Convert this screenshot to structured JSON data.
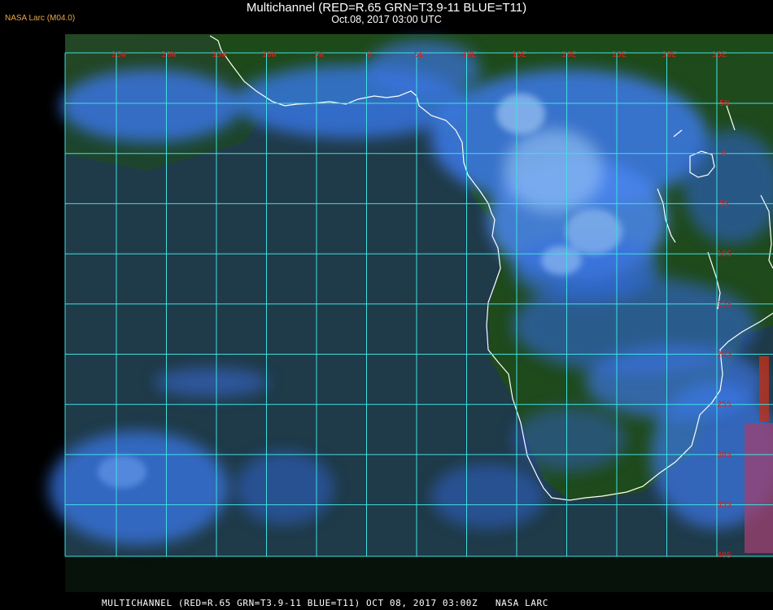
{
  "header": {
    "title": "Multichannel (RED=R.65 GRN=T3.9-11 BLUE=T11)",
    "subtitle": "Oct.08, 2017 03:00 UTC",
    "credit": "NASA Larc (M04.0)"
  },
  "footer": {
    "caption": "MULTICHANNEL (RED=R.65 GRN=T3.9-11 BLUE=T11) OCT 08, 2017 03:00Z   NASA LARC"
  },
  "map": {
    "region": "Southern Africa / South Atlantic",
    "lon_labels": [
      "25W",
      "20W",
      "15W",
      "10W",
      "5W",
      "0",
      "5E",
      "10E",
      "15E",
      "20E",
      "25E",
      "30E",
      "35E"
    ],
    "lat_labels": [
      "5N",
      "0",
      "5S",
      "10S",
      "15S",
      "20S",
      "25S",
      "30S",
      "35S",
      "40S"
    ],
    "colors": {
      "grid": "#3fe0e0",
      "grid_label": "#e02020",
      "coastline": "#ffffff",
      "land_base": "#1f4a1a",
      "ocean_base": "#1f3a4a",
      "cloud": "#3a78e8",
      "cloud_high": "#8ab8f0"
    }
  }
}
